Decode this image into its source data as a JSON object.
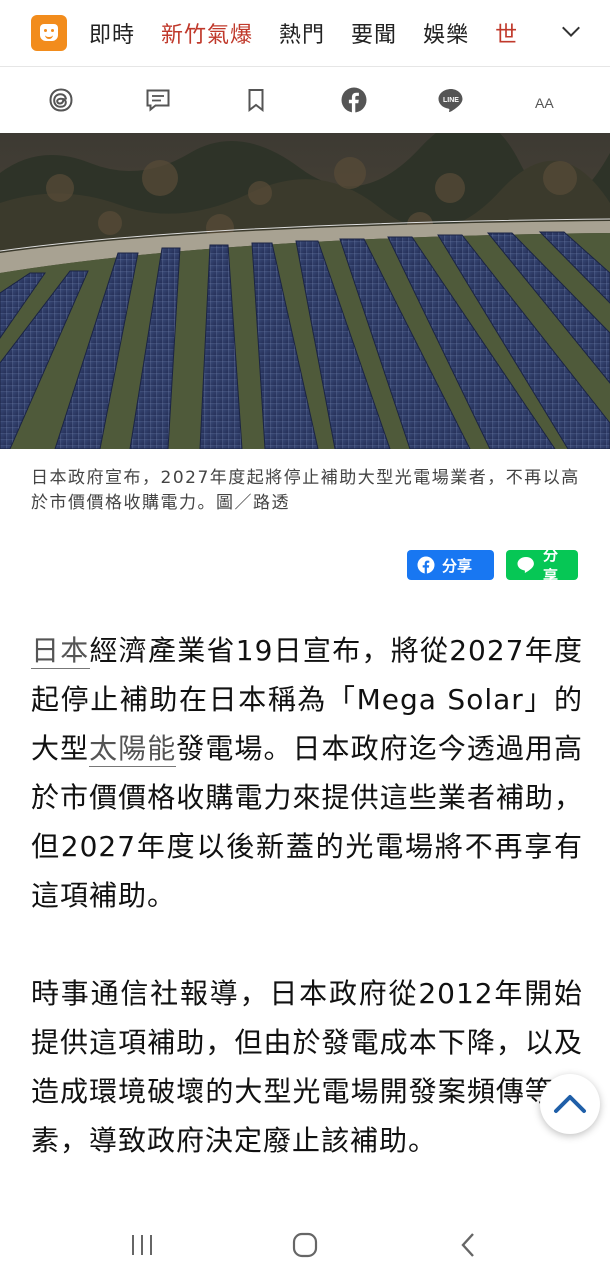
{
  "nav": {
    "logo_icon": "udn-face-logo-icon",
    "tabs": [
      {
        "label": "即時",
        "style": "normal"
      },
      {
        "label": "新竹氣爆",
        "style": "hot"
      },
      {
        "label": "熱門",
        "style": "normal"
      },
      {
        "label": "要聞",
        "style": "normal"
      },
      {
        "label": "娛樂",
        "style": "normal"
      },
      {
        "label": "世",
        "style": "hot"
      }
    ],
    "more_icon": "chevron-down-icon"
  },
  "toolbar": {
    "icons": [
      "threads-icon",
      "comment-icon",
      "bookmark-icon",
      "facebook-icon",
      "line-icon",
      "font-size-icon"
    ],
    "line_label": "LINE",
    "font_label": "AA"
  },
  "hero": {
    "image": "solar-farm-photo"
  },
  "caption": {
    "text": "日本政府宣布，2027年度起將停止補助大型光電場業者，不再以高於市價價格收購電力。圖／路透"
  },
  "share": {
    "facebook_label": "分享",
    "line_label": "分享"
  },
  "article": {
    "p1_kw1": "日本",
    "p1_a": "經濟產業省19日宣布，將從2027年度起停止補助在日本稱為「Mega Solar」的大型",
    "p1_kw2": "太陽能",
    "p1_b": "發電場。日本政府迄今透過用高於市價價格收購電力來提供這些業者補助，但2027年度以後新蓋的光電場將不再享有這項補助。",
    "p2": "時事通信社報導，日本政府從2012年開始提供這項補助，但由於發電成本下降，以及造成環境破壞的大型光電場開發案頻傳等因素，導致政府決定廢止該補助。"
  },
  "colors": {
    "accent_red": "#c0392b",
    "logo_orange": "#f28c1c",
    "facebook_blue": "#1877f2",
    "line_green": "#06c755"
  },
  "system_nav": {
    "icons": [
      "recent-apps-icon",
      "home-icon",
      "back-icon"
    ]
  }
}
